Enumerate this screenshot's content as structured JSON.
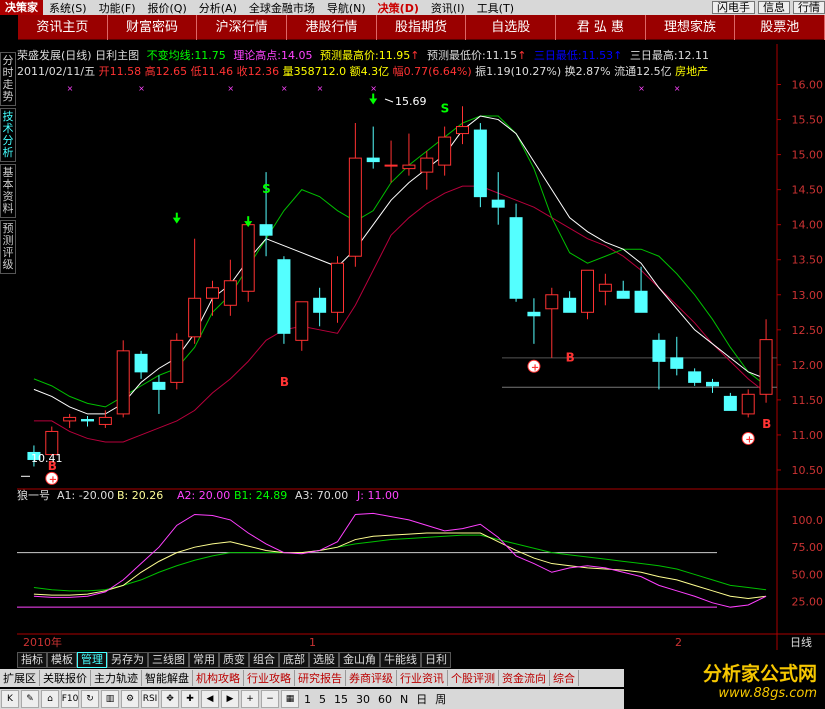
{
  "menubar": {
    "logo": "决策家",
    "items": [
      "系统(S)",
      "功能(F)",
      "报价(Q)",
      "分析(A)",
      "全球金融市场",
      "导航(N)",
      "决策(D)",
      "资讯(I)",
      "工具(T)"
    ],
    "active_index": 6,
    "right_items": [
      "闪电手",
      "信息",
      "行情"
    ]
  },
  "navbar": [
    "资讯主页",
    "财富密码",
    "沪深行情",
    "港股行情",
    "股指期货",
    "自选股",
    "君 弘 惠",
    "理想家族",
    "股票池"
  ],
  "sidetabs": [
    {
      "label": "分时走势",
      "active": false
    },
    {
      "label": "技术分析",
      "active": true
    },
    {
      "label": "基本资料",
      "active": false
    },
    {
      "label": "预测评级",
      "active": false
    }
  ],
  "header": {
    "stock": "荣盛发展(日线) 日利主图",
    "invariant_label": "不变均线:",
    "invariant_value": "11.75",
    "theory_label": "理论高点:",
    "theory_value": "14.05",
    "pred_high_label": "预测最高价:",
    "pred_high_value": "11.95",
    "pred_low_label": "预测最低价:",
    "pred_low_value": "11.15",
    "three_low_label": "三日最低:",
    "three_low_value": "11.53",
    "three_high_label": "三日最高:",
    "three_high_value": "12.11",
    "date": "2011/02/11/五",
    "open": "开11.58",
    "high": "高12.65",
    "low": "低11.46",
    "close": "收12.36",
    "volume": "量358712.0",
    "amount": "额4.3亿",
    "change": "幅0.77(6.64%)",
    "amplitude": "振1.19(10.27%)",
    "turnover": "换2.87%",
    "float": "流通12.5亿",
    "sector": "房地产"
  },
  "price_axis": [
    "16.00",
    "15.50",
    "15.00",
    "14.50",
    "14.00",
    "13.50",
    "13.00",
    "12.50",
    "12.00",
    "11.50",
    "11.00",
    "10.50"
  ],
  "annotations": {
    "high_label": "15.69",
    "low_label": "10.41"
  },
  "indicator": {
    "name": "狼一号",
    "a1": "A1: -20.00",
    "b": "B: 20.26",
    "a2": "A2: 20.00",
    "b1": "B1: 24.89",
    "a3": "A3: 70.00",
    "j": "J: 11.00",
    "axis": [
      "100.0",
      "75.00",
      "50.00",
      "25.00"
    ]
  },
  "timeaxis": {
    "year": "2010年",
    "m1": "1",
    "m2": "2",
    "period": "日线"
  },
  "bottomtabs": [
    "指标",
    "模板",
    "管理",
    "另存为",
    "三线图",
    "常用",
    "质变",
    "组合",
    "底部",
    "选股",
    "金山角",
    "牛能线",
    "日利"
  ],
  "bottomtabs_active": 2,
  "bottombar": [
    "扩展区",
    "关联报价",
    "主力轨迹",
    "智能解盘",
    "机构攻略",
    "行业攻略",
    "研究报告",
    "券商评级",
    "行业资讯",
    "个股评测",
    "资金流向",
    "综合"
  ],
  "bottombar_highlight": [
    4,
    5,
    6,
    7,
    8,
    9,
    10
  ],
  "toolbar_numbers": [
    "1",
    "5",
    "15",
    "30",
    "60",
    "N",
    "日",
    "周"
  ],
  "brand": {
    "name": "分析家公式网",
    "url": "www.88gs.com"
  },
  "colors": {
    "up": "#ff3232",
    "down": "#54ffff",
    "ma_white": "#ffffff",
    "ma_green": "#00c000",
    "ma_red": "#b8003c",
    "magenta": "#ff40ff",
    "yellow": "#ffff90"
  },
  "chart_data": {
    "type": "candlestick",
    "candles": [
      {
        "o": 10.75,
        "h": 10.85,
        "l": 10.55,
        "c": 10.65
      },
      {
        "o": 10.72,
        "h": 11.12,
        "l": 10.7,
        "c": 11.05
      },
      {
        "o": 11.2,
        "h": 11.3,
        "l": 11.1,
        "c": 11.25
      },
      {
        "o": 11.22,
        "h": 11.27,
        "l": 11.12,
        "c": 11.2
      },
      {
        "o": 11.15,
        "h": 11.35,
        "l": 11.1,
        "c": 11.25
      },
      {
        "o": 11.3,
        "h": 12.35,
        "l": 11.25,
        "c": 12.2
      },
      {
        "o": 12.15,
        "h": 12.2,
        "l": 11.8,
        "c": 11.9
      },
      {
        "o": 11.75,
        "h": 11.85,
        "l": 11.3,
        "c": 11.65
      },
      {
        "o": 11.75,
        "h": 12.45,
        "l": 11.65,
        "c": 12.35
      },
      {
        "o": 12.4,
        "h": 13.8,
        "l": 12.3,
        "c": 12.95
      },
      {
        "o": 12.95,
        "h": 13.2,
        "l": 12.7,
        "c": 13.1
      },
      {
        "o": 12.85,
        "h": 13.5,
        "l": 12.7,
        "c": 13.2
      },
      {
        "o": 13.05,
        "h": 14.05,
        "l": 12.9,
        "c": 14.0
      },
      {
        "o": 14.0,
        "h": 14.75,
        "l": 13.55,
        "c": 13.85
      },
      {
        "o": 13.5,
        "h": 13.55,
        "l": 12.3,
        "c": 12.45
      },
      {
        "o": 12.35,
        "h": 12.75,
        "l": 12.2,
        "c": 12.9
      },
      {
        "o": 12.95,
        "h": 13.1,
        "l": 12.55,
        "c": 12.75
      },
      {
        "o": 12.75,
        "h": 13.55,
        "l": 12.6,
        "c": 13.45
      },
      {
        "o": 13.55,
        "h": 15.45,
        "l": 13.4,
        "c": 14.95
      },
      {
        "o": 14.95,
        "h": 15.4,
        "l": 14.8,
        "c": 14.9
      },
      {
        "o": 14.85,
        "h": 15.2,
        "l": 14.6,
        "c": 14.85
      },
      {
        "o": 14.8,
        "h": 15.3,
        "l": 14.7,
        "c": 14.85
      },
      {
        "o": 14.75,
        "h": 15.05,
        "l": 14.5,
        "c": 14.95
      },
      {
        "o": 14.85,
        "h": 15.4,
        "l": 14.7,
        "c": 15.25
      },
      {
        "o": 15.3,
        "h": 15.69,
        "l": 15.15,
        "c": 15.4
      },
      {
        "o": 15.35,
        "h": 15.45,
        "l": 14.25,
        "c": 14.4
      },
      {
        "o": 14.35,
        "h": 14.75,
        "l": 14.0,
        "c": 14.25
      },
      {
        "o": 14.1,
        "h": 14.3,
        "l": 12.9,
        "c": 12.95
      },
      {
        "o": 12.75,
        "h": 12.95,
        "l": 12.3,
        "c": 12.7
      },
      {
        "o": 12.8,
        "h": 13.1,
        "l": 12.1,
        "c": 13.0
      },
      {
        "o": 12.95,
        "h": 13.05,
        "l": 12.75,
        "c": 12.75
      },
      {
        "o": 12.75,
        "h": 13.25,
        "l": 12.65,
        "c": 13.35
      },
      {
        "o": 13.05,
        "h": 13.3,
        "l": 12.85,
        "c": 13.15
      },
      {
        "o": 13.05,
        "h": 13.2,
        "l": 12.95,
        "c": 12.95
      },
      {
        "o": 13.05,
        "h": 13.4,
        "l": 12.75,
        "c": 12.75
      },
      {
        "o": 12.35,
        "h": 12.45,
        "l": 11.65,
        "c": 12.05
      },
      {
        "o": 12.1,
        "h": 12.4,
        "l": 11.85,
        "c": 11.95
      },
      {
        "o": 11.9,
        "h": 11.95,
        "l": 11.7,
        "c": 11.75
      },
      {
        "o": 11.75,
        "h": 11.8,
        "l": 11.6,
        "c": 11.7
      },
      {
        "o": 11.55,
        "h": 11.6,
        "l": 11.35,
        "c": 11.35
      },
      {
        "o": 11.3,
        "h": 11.65,
        "l": 11.25,
        "c": 11.58
      },
      {
        "o": 11.58,
        "h": 12.65,
        "l": 11.46,
        "c": 12.36
      }
    ],
    "ma_white": [
      11.65,
      11.55,
      11.4,
      11.3,
      11.3,
      11.45,
      11.75,
      11.95,
      12.1,
      12.45,
      12.95,
      13.15,
      13.5,
      13.8,
      13.7,
      13.6,
      13.5,
      13.4,
      13.65,
      14.0,
      14.35,
      14.6,
      14.8,
      15.0,
      15.35,
      15.55,
      15.5,
      15.3,
      14.9,
      14.5,
      14.1,
      13.9,
      13.75,
      13.65,
      13.45,
      13.1,
      12.8,
      12.5,
      12.3,
      12.1,
      11.9,
      11.8
    ],
    "ma_green": [
      11.8,
      11.7,
      11.55,
      11.45,
      11.4,
      11.55,
      11.7,
      11.85,
      11.95,
      12.25,
      12.75,
      13.0,
      13.4,
      13.8,
      14.2,
      14.5,
      14.4,
      14.2,
      14.05,
      14.2,
      14.6,
      14.85,
      15.05,
      15.25,
      15.45,
      15.55,
      15.55,
      15.3,
      14.8,
      14.1,
      13.6,
      13.45,
      13.55,
      13.65,
      13.65,
      13.55,
      13.3,
      13.0,
      12.65,
      12.25,
      11.9,
      11.7
    ],
    "ma_red": [
      11.2,
      11.2,
      11.05,
      10.95,
      10.9,
      10.9,
      11.0,
      11.1,
      11.2,
      11.35,
      11.6,
      11.8,
      12.05,
      12.35,
      12.5,
      12.55,
      12.5,
      12.45,
      12.85,
      13.35,
      13.85,
      14.1,
      14.3,
      14.45,
      14.55,
      14.55,
      14.45,
      14.35,
      14.25,
      14.1,
      13.95,
      13.8,
      13.7,
      13.55,
      13.35,
      13.1,
      12.85,
      12.6,
      12.3,
      12.05,
      11.8,
      11.6
    ],
    "osc_magenta": [
      30,
      29,
      29,
      30,
      34,
      45,
      60,
      75,
      95,
      105,
      104,
      100,
      88,
      78,
      70,
      69,
      72,
      80,
      105,
      106,
      103,
      100,
      95,
      90,
      92,
      96,
      84,
      67,
      60,
      52,
      56,
      58,
      56,
      52,
      48,
      40,
      35,
      30,
      24,
      20,
      22,
      30
    ],
    "osc_yellow": [
      32,
      31,
      31,
      32,
      35,
      40,
      52,
      62,
      70,
      75,
      78,
      80,
      76,
      72,
      70,
      70,
      72,
      75,
      82,
      85,
      86,
      87,
      88,
      88,
      88,
      88,
      80,
      72,
      65,
      60,
      58,
      56,
      55,
      54,
      52,
      48,
      45,
      40,
      35,
      30,
      28,
      30
    ],
    "osc_green": [
      38,
      36,
      35,
      35,
      36,
      40,
      45,
      52,
      58,
      63,
      67,
      70,
      70,
      70,
      70,
      70,
      72,
      75,
      78,
      80,
      82,
      83,
      84,
      85,
      86,
      86,
      82,
      78,
      74,
      70,
      68,
      66,
      64,
      62,
      60,
      58,
      55,
      50,
      45,
      40,
      38,
      36
    ],
    "osc_axis": [
      0,
      110
    ]
  }
}
